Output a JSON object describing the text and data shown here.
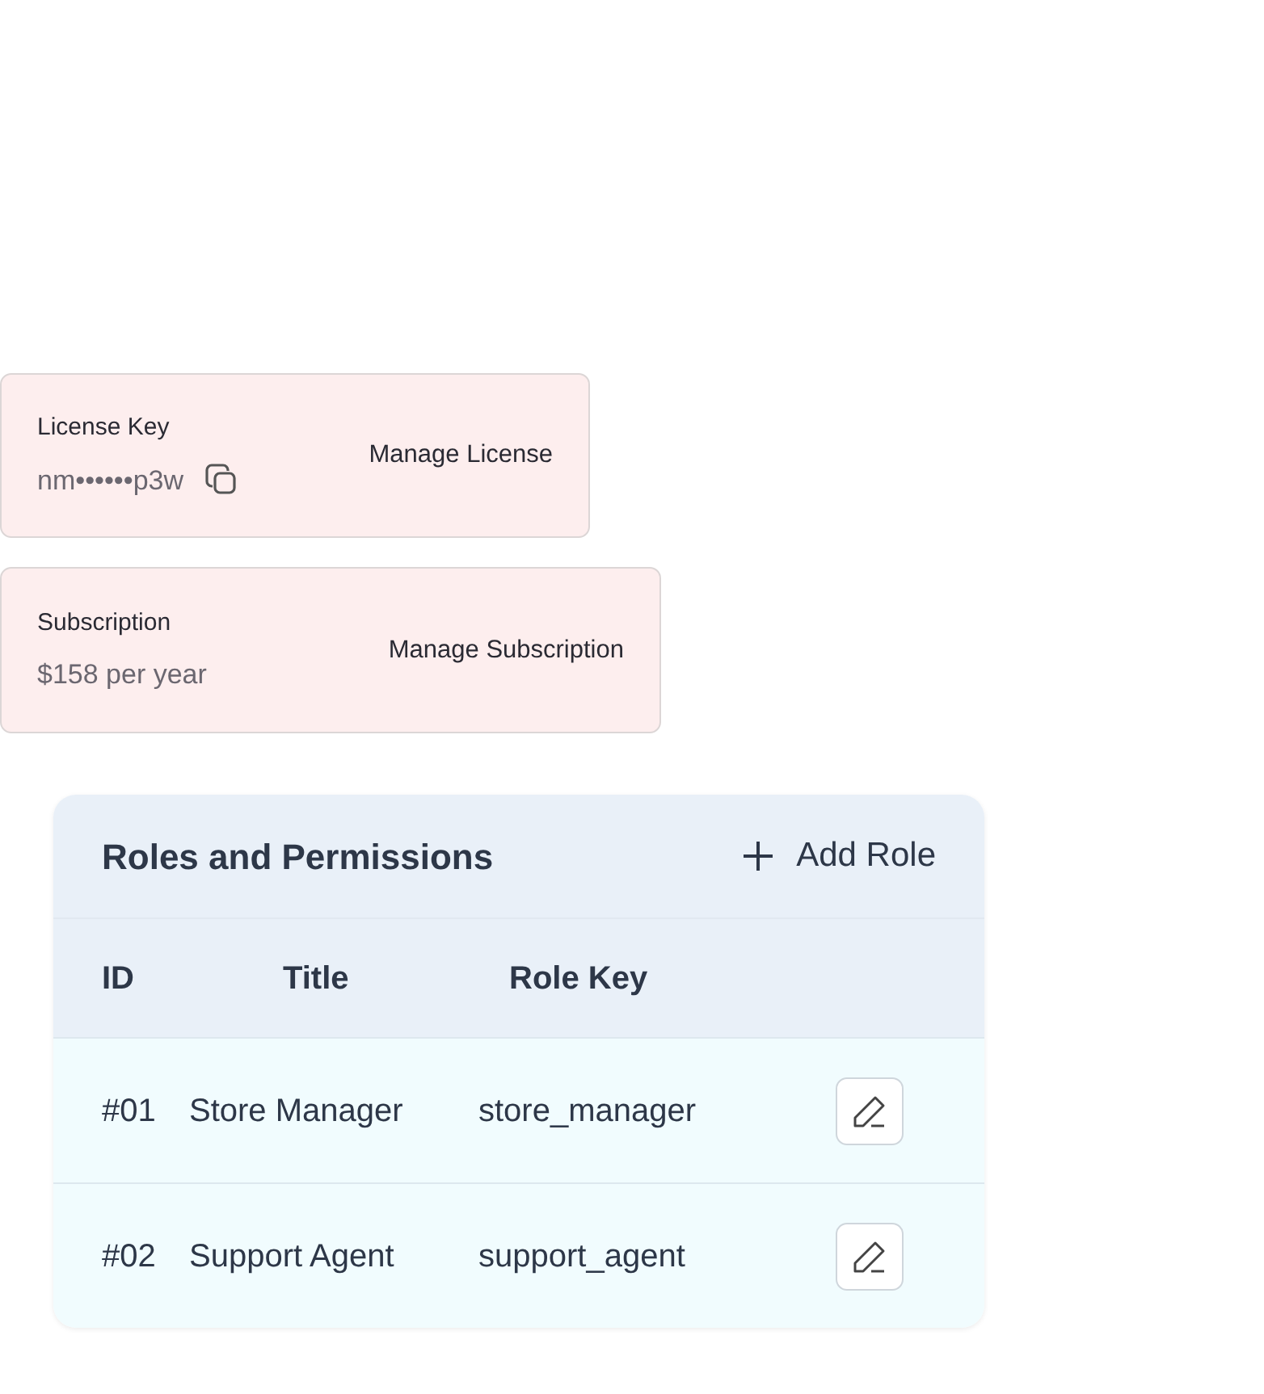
{
  "license": {
    "label": "License Key",
    "value": "nm••••••p3w",
    "action": "Manage License"
  },
  "subscription": {
    "label": "Subscription",
    "value": "$158 per year",
    "action": "Manage Subscription"
  },
  "roles": {
    "title": "Roles and Permissions",
    "add_button": "Add Role",
    "columns": [
      "ID",
      "Title",
      "Role Key"
    ],
    "rows": [
      {
        "id": "#01",
        "title": "Store Manager",
        "key": "store_manager"
      },
      {
        "id": "#02",
        "title": "Support Agent",
        "key": "support_agent"
      }
    ]
  }
}
